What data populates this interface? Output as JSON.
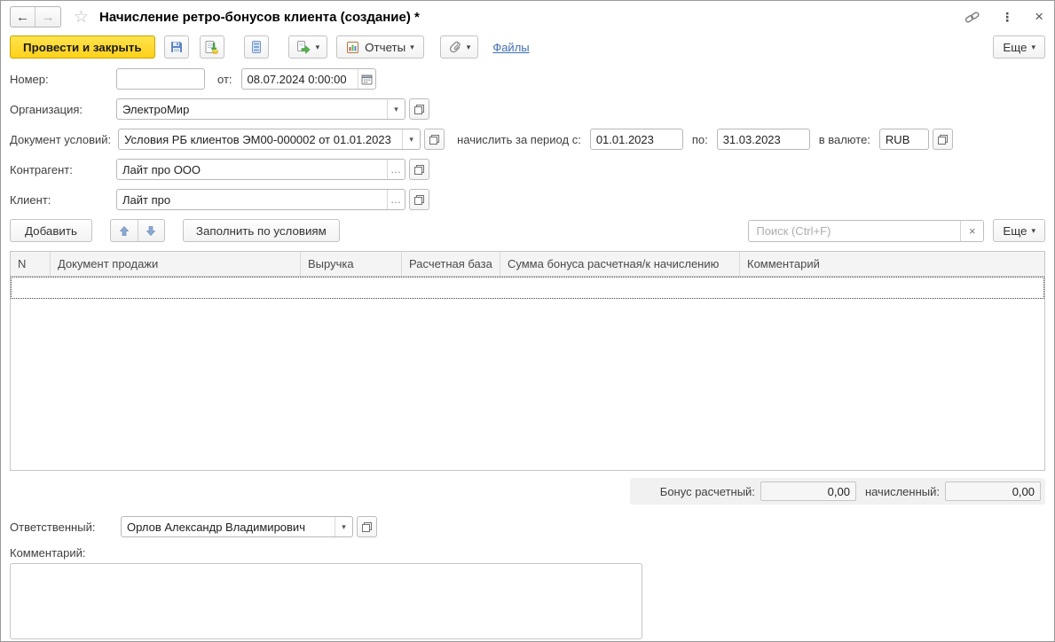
{
  "icons": {
    "back": "←",
    "forward": "→",
    "star": "☆",
    "kebab": "⋮",
    "close": "×",
    "caret": "▾",
    "ellipsis": "…",
    "clear": "×"
  },
  "window": {
    "title": "Начисление ретро-бонусов клиента (создание) *"
  },
  "toolbar": {
    "post_and_close": "Провести и закрыть",
    "reports": "Отчеты",
    "files_link": "Файлы",
    "more": "Еще"
  },
  "fields": {
    "number": {
      "label": "Номер:",
      "value": ""
    },
    "date": {
      "label": "от:",
      "value": "08.07.2024  0:00:00"
    },
    "organization": {
      "label": "Организация:",
      "value": "ЭлектроМир"
    },
    "terms_doc": {
      "label": "Документ условий:",
      "value": "Условия РБ клиентов ЭМ00-000002 от 01.01.2023"
    },
    "period": {
      "from_label": "начислить за период с:",
      "from": "01.01.2023",
      "to_label": "по:",
      "to": "31.03.2023",
      "currency_label": "в валюте:",
      "currency": "RUB"
    },
    "counterparty": {
      "label": "Контрагент:",
      "value": "Лайт про ООО"
    },
    "client": {
      "label": "Клиент:",
      "value": "Лайт про"
    },
    "responsible": {
      "label": "Ответственный:",
      "value": "Орлов Александр Владимирович"
    },
    "comment": {
      "label": "Комментарий:",
      "value": ""
    }
  },
  "cmdbar": {
    "add": "Добавить",
    "fill_by_terms": "Заполнить по условиям",
    "search_placeholder": "Поиск (Ctrl+F)",
    "more": "Еще"
  },
  "table": {
    "columns": [
      "N",
      "Документ продажи",
      "Выручка",
      "Расчетная база",
      "Сумма бонуса расчетная/к начислению",
      "Комментарий"
    ],
    "rows": []
  },
  "totals": {
    "calc_label": "Бонус расчетный:",
    "calc_value": "0,00",
    "accrued_label": "начисленный:",
    "accrued_value": "0,00"
  }
}
